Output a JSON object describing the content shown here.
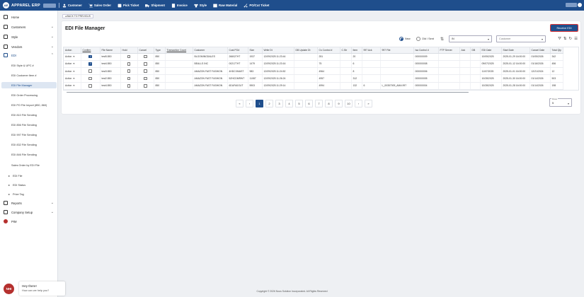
{
  "app": {
    "name": "APPAREL ERP",
    "logo_letters": "AE"
  },
  "nav": [
    {
      "label": "Customer",
      "icon": "customer-icon"
    },
    {
      "label": "Sales Order",
      "icon": "cart-icon"
    },
    {
      "label": "Pick Ticket",
      "icon": "ticket-icon"
    },
    {
      "label": "Shipment",
      "icon": "truck-icon"
    },
    {
      "label": "Invoice",
      "icon": "invoice-icon"
    },
    {
      "label": "Style",
      "icon": "shirt-icon"
    },
    {
      "label": "Raw Material",
      "icon": "fabric-icon"
    },
    {
      "label": "PO/Cut Ticket",
      "icon": "scissors-icon"
    }
  ],
  "sidebar": {
    "home": "Home",
    "customers": "Customers",
    "style": "Style",
    "vendors": "Vendors",
    "edi": "EDI",
    "edi_items": [
      "EDI Style & UPC #",
      "EDI Customer Item #",
      "EDI File Manager",
      "EDI Order Processing",
      "EDI PO File Import (850, 860)",
      "EDI 810 File Sending",
      "EDI 856 File Sending",
      "EDI 997 File Sending",
      "EDI 832 File Sending",
      "EDI 846 File Sending",
      "Sales Order by EDI File"
    ],
    "groups": [
      "EDI File",
      "EDI Status",
      "Price Tag"
    ],
    "reports": "Reports",
    "company_setup": "Company Setup",
    "pim": "PIM"
  },
  "back_label": "BACK TO PREVIOUS",
  "page_title": "EDI File Manager",
  "receive_label": "Receive EDI",
  "filters": {
    "radio_new": "New",
    "radio_old": "Old / Sent",
    "direction_value": "IN",
    "customer_placeholder": "Customer"
  },
  "table": {
    "columns": [
      "Action",
      "Confirm",
      "File Name",
      "Hold",
      "Cancel",
      "Type",
      "Transaction Count",
      "Customer",
      "Cust PO#",
      "Size",
      "Write Dt",
      "DB Update Dt",
      "Cs Control #",
      "C.Str",
      "Item",
      "997 Ack",
      "997 File",
      "Isa Control #",
      "FTP Server",
      "Ack",
      "DB",
      "EDI Date",
      "Start Date",
      "Cancel Date",
      "Total Qty"
    ],
    "rows": [
      {
        "action": "Action",
        "confirm": true,
        "file": "test5.850",
        "hold": false,
        "cancel": false,
        "type": "850",
        "tcount": "",
        "customer": "BLOOMINGDALES",
        "po": "266027HT",
        "size": "1937",
        "write": "12/09/2025 11:23:44",
        "dbup": "",
        "cs": "251",
        "cstr": "",
        "item": "20",
        "ack997": "",
        "file997": "",
        "isa": "000000009",
        "ftp": "",
        "ack": "",
        "db": "",
        "edi": "10/05/2025",
        "start": "2025-01-29 16:00:00",
        "canceldt": "01/05/2026",
        "qty": "342"
      },
      {
        "action": "Action",
        "confirm": true,
        "file": "test4.850",
        "hold": false,
        "cancel": false,
        "type": "850",
        "tcount": "",
        "customer": "BEALLS INC",
        "po": "002177HT",
        "size": "1479",
        "write": "12/09/2025 11:23:16",
        "dbup": "",
        "cs": "75",
        "cstr": "",
        "item": "6",
        "ack997": "",
        "file997": "",
        "isa": "000000008",
        "ftp": "",
        "ack": "",
        "db": "",
        "edi": "09/07/2025",
        "start": "2025-01-12 16:00:00",
        "canceldt": "01/16/2026",
        "qty": "456"
      },
      {
        "action": "Action",
        "confirm": false,
        "file": "test3.850",
        "hold": false,
        "cancel": false,
        "type": "850",
        "tcount": "",
        "customer": "AMAZON FAST FASHION",
        "po": "4HDCXMAST",
        "size": "983",
        "write": "12/09/2025 11:24:52",
        "dbup": "",
        "cs": "4964",
        "cstr": "",
        "item": "8",
        "ack997": "",
        "file997": "",
        "isa": "000000006",
        "ftp": "",
        "ack": "",
        "db": "",
        "edi": "11/07/2025",
        "start": "2025-01-01 16:00:00",
        "canceldt": "12/21/2024",
        "qty": "12"
      },
      {
        "action": "Action",
        "confirm": false,
        "file": "test2.850",
        "hold": false,
        "cancel": false,
        "type": "850",
        "tcount": "",
        "customer": "AMAZON FAST FASHION",
        "po": "5ZHCDMRWT",
        "size": "11087",
        "write": "12/09/2025 11:26:24",
        "dbup": "",
        "cs": "4957",
        "cstr": "",
        "item": "312",
        "ack997": "",
        "file997": "",
        "isa": "000000005",
        "ftp": "",
        "ack": "",
        "db": "",
        "edi": "10/28/2025",
        "start": "2025-01-30 16:00:00",
        "canceldt": "01/14/2026",
        "qty": "503"
      },
      {
        "action": "Action",
        "confirm": false,
        "file": "test4.850",
        "hold": false,
        "cancel": false,
        "type": "850",
        "tcount": "",
        "customer": "AMAZON FAST FASHION",
        "po": "6DUFA0OUT",
        "size": "5903",
        "write": "12/09/2025 11:29:14",
        "dbup": "",
        "cs": "4994",
        "cstr": "",
        "item": "132",
        "ack997": "6",
        "file997": "L_00357009_AMA.997",
        "isa": "000000004",
        "ftp": "",
        "ack": "",
        "db": "",
        "edi": "10/28/2025",
        "start": "2025-01-28 16:00:00",
        "canceldt": "01/14/2026",
        "qty": "198"
      }
    ]
  },
  "pagination": {
    "first": "«",
    "prev": "‹",
    "pages": [
      "1",
      "2",
      "3",
      "4",
      "5",
      "6",
      "7",
      "8",
      "9",
      "10"
    ],
    "current": "1",
    "next": "›",
    "last": "»",
    "rows_label": "Rows",
    "rows_value": "5"
  },
  "chat": {
    "avatar": "NHI",
    "title": "Hey there!",
    "subtitle": "How can we help you?"
  },
  "copyright": "Copyright © 2026 Nous Solution Incorporated. All Rights Reserved",
  "colors": {
    "primary": "#1f4e8c",
    "highlight": "#dd3333"
  }
}
